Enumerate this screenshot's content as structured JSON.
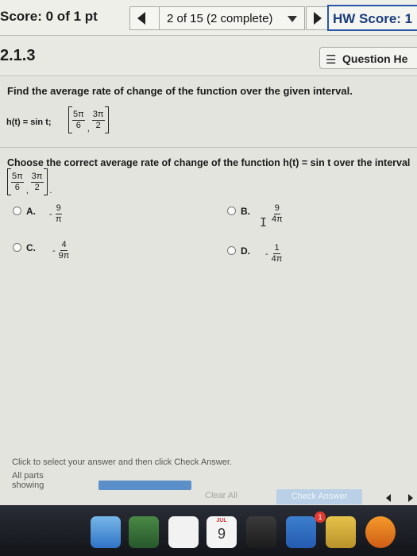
{
  "header": {
    "score": "Score: 0 of 1 pt",
    "question_counter": "2 of 15 (2 complete)",
    "hw_score": "HW Score: 1"
  },
  "subheader": {
    "question_number": "2.1.3",
    "help_label": "Question He"
  },
  "question": {
    "prompt": "Find the average rate of change of the function over the given interval.",
    "function": "h(t) = sin t;",
    "interval": [
      {
        "num": "5π",
        "den": "6"
      },
      {
        "num": "3π",
        "den": "2"
      }
    ],
    "choose": "Choose the correct average rate of change of the function h(t) = sin t over the interval"
  },
  "options": [
    {
      "letter": "A.",
      "negative": "-",
      "num": "9",
      "den": "π"
    },
    {
      "letter": "B.",
      "negative": "",
      "num": "9",
      "den": "4π"
    },
    {
      "letter": "C.",
      "negative": "-",
      "num": "4",
      "den": "9π"
    },
    {
      "letter": "D.",
      "negative": "-",
      "num": "1",
      "den": "4π"
    }
  ],
  "footer": {
    "instruction": "Click to select your answer and then click Check Answer.",
    "parts_line1": "All parts",
    "parts_line2": "showing",
    "clear_label": "Clear All",
    "check_label": "Check Answer"
  },
  "dock": {
    "calendar_month": "JUL",
    "calendar_day": "9",
    "badge_count": "1"
  },
  "icons": {
    "help": "list-icon",
    "cursor": "text-cursor-icon"
  }
}
